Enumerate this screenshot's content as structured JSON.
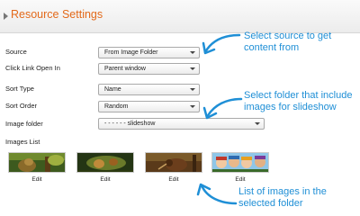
{
  "panel": {
    "title": "Resource Settings"
  },
  "form": {
    "source": {
      "label": "Source",
      "value": "From Image Folder"
    },
    "click_link": {
      "label": "Click Link Open In",
      "value": "Parent window"
    },
    "sort_type": {
      "label": "Sort Type",
      "value": "Name"
    },
    "sort_order": {
      "label": "Sort Order",
      "value": "Random"
    },
    "image_folder": {
      "label": "Image folder",
      "value": "- - - - - - slideshow"
    }
  },
  "images_list": {
    "label": "Images List",
    "items": [
      {
        "edit_label": "Edit"
      },
      {
        "edit_label": "Edit"
      },
      {
        "edit_label": "Edit"
      },
      {
        "edit_label": "Edit"
      }
    ]
  },
  "annotations": {
    "source_line1": "Select source to get",
    "source_line2": "content from",
    "folder_line1": "Select folder that include",
    "folder_line2": "images for slideshow",
    "images_line1": "List of images in the",
    "images_line2": "selected folder"
  },
  "colors": {
    "title": "#e36a1b",
    "annotation": "#1f8fd6"
  }
}
